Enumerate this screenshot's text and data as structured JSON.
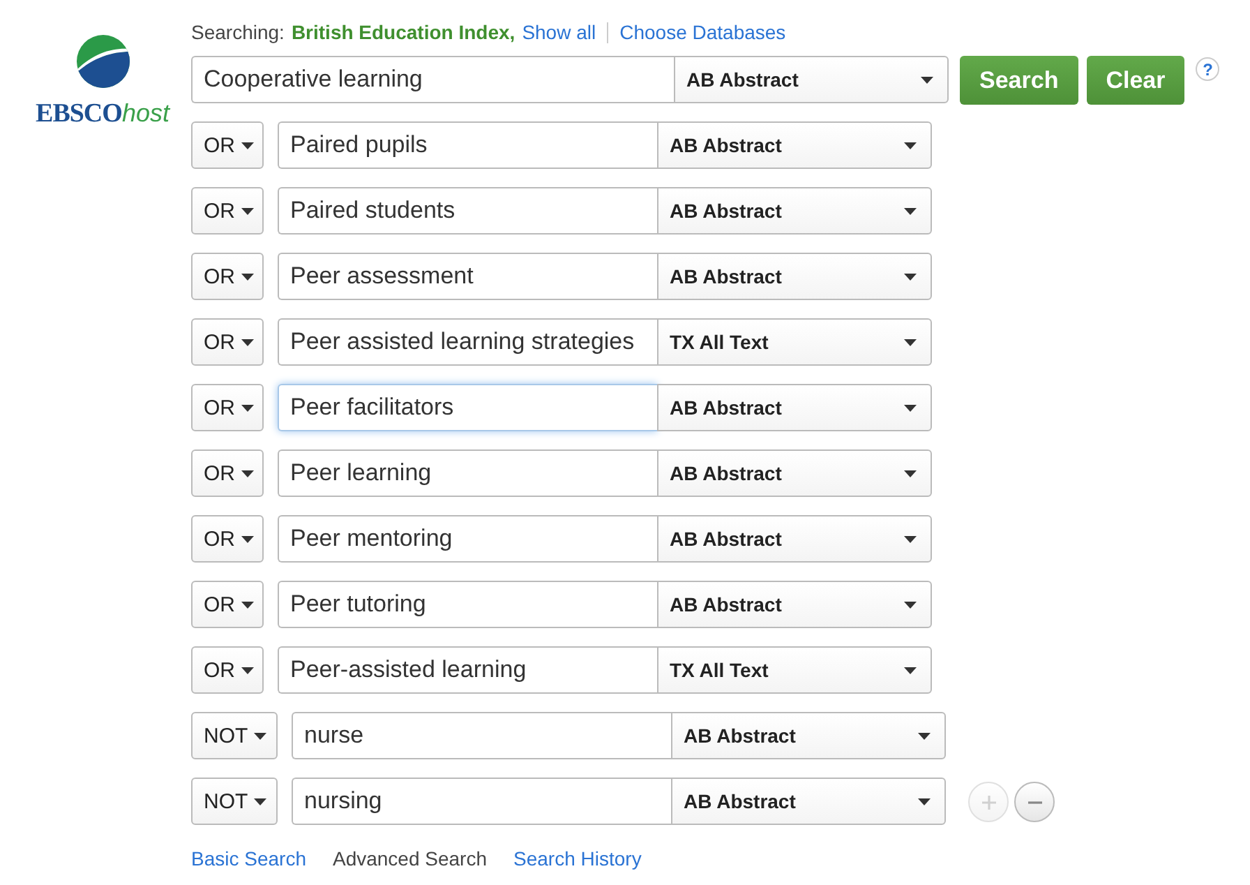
{
  "logo": {
    "brand": "EBSCO",
    "suffix": "host"
  },
  "searching": {
    "label": "Searching:",
    "database": "British Education Index,",
    "show_all": "Show all",
    "choose": "Choose Databases"
  },
  "rows": [
    {
      "operator": null,
      "term": "Cooperative learning",
      "field": "AB Abstract",
      "focused": false
    },
    {
      "operator": "OR",
      "term": "Paired pupils",
      "field": "AB Abstract",
      "focused": false
    },
    {
      "operator": "OR",
      "term": "Paired students",
      "field": "AB Abstract",
      "focused": false
    },
    {
      "operator": "OR",
      "term": "Peer assessment",
      "field": "AB Abstract",
      "focused": false
    },
    {
      "operator": "OR",
      "term": "Peer assisted learning strategies",
      "field": "TX All Text",
      "focused": false
    },
    {
      "operator": "OR",
      "term": "Peer facilitators",
      "field": "AB Abstract",
      "focused": true
    },
    {
      "operator": "OR",
      "term": "Peer learning",
      "field": "AB Abstract",
      "focused": false
    },
    {
      "operator": "OR",
      "term": "Peer mentoring",
      "field": "AB Abstract",
      "focused": false
    },
    {
      "operator": "OR",
      "term": "Peer tutoring",
      "field": "AB Abstract",
      "focused": false
    },
    {
      "operator": "OR",
      "term": "Peer-assisted learning",
      "field": "TX All Text",
      "focused": false
    },
    {
      "operator": "NOT",
      "term": "nurse",
      "field": "AB Abstract",
      "focused": false
    },
    {
      "operator": "NOT",
      "term": "nursing",
      "field": "AB Abstract",
      "focused": false
    }
  ],
  "buttons": [
    "Search",
    "Clear"
  ],
  "help": "?",
  "add_row": {
    "disabled": true
  },
  "remove_row": {
    "disabled": false
  },
  "footer_links": [
    {
      "label": "Basic Search",
      "selected": false
    },
    {
      "label": "Advanced Search",
      "selected": true
    },
    {
      "label": "Search History",
      "selected": false
    }
  ]
}
